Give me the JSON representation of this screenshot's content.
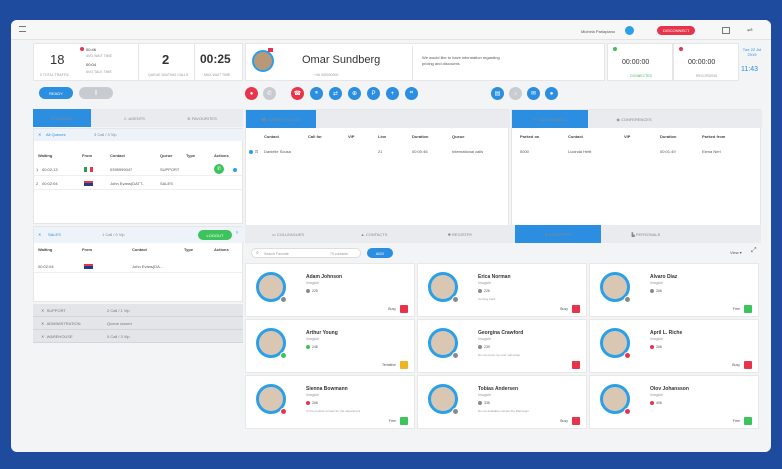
{
  "header": {
    "user": "Michela Parlapiano",
    "status_button": "DISCONNECT"
  },
  "stats": {
    "calls_count": "18",
    "calls_label": "0 TOTAL TRAFFIC",
    "t1": "00:46",
    "t1_label": "AVG WAIT TIME",
    "t2": "00:04",
    "t2_label": "AVG TALK TIME",
    "queue_count": "2",
    "queue_label": "QUEUE WAITING CALLS",
    "waittime": "00:25",
    "waittime_label": "MAX WAIT TIME"
  },
  "caller": {
    "name": "Omar Sundberg",
    "sub": "+46 000000000",
    "note": "We would like to have information regarding pricing and discounts",
    "timer1": "00:00:00",
    "timer1_label": "CONNECTED",
    "timer2": "00:00:00",
    "timer2_label": "RECORDING",
    "date": "Tue 22 Jul 2019",
    "time": "11:43"
  },
  "controls": {
    "pause": "READY",
    "pause2": "||"
  },
  "left_tabs": [
    "QUEUES",
    "AGENTS",
    "FAVOURITES"
  ],
  "queue_info": {
    "label": "All Queues",
    "count": "3 Call / 3 Vip"
  },
  "queue_headers": [
    "Waiting",
    "From",
    "Contact",
    "Queue",
    "Type",
    "Actions"
  ],
  "queue_rows": [
    {
      "idx": "1",
      "waiting": "00:02:13",
      "contact": "0395999047",
      "queue": "SUPPORT"
    },
    {
      "idx": "2",
      "waiting": "00:02:04",
      "contact": "John Evans(DATT..",
      "queue": "SALES"
    }
  ],
  "sales": {
    "label": "SALES",
    "count": "1 Call / 0 Vip",
    "logout": "LOGOUT"
  },
  "sales_headers": [
    "Waiting",
    "From",
    "Contact",
    "Type",
    "Actions"
  ],
  "sales_rows": [
    {
      "waiting": "00:02:04",
      "contact": "John Evans(DA..."
    }
  ],
  "groups": [
    {
      "name": "SUPPORT",
      "info": "2 Call / 1 Vip"
    },
    {
      "name": "ADMINISTRATION",
      "info": "Queue closed"
    },
    {
      "name": "WAREHOUSE",
      "info": "0 Call / 3 Vip"
    }
  ],
  "current_calls": {
    "tab": "CURRENT CALLS",
    "headers": [
      "Contact",
      "Call for",
      "VIP",
      "Line",
      "Duration",
      "Queue"
    ],
    "row": {
      "contact": "Danielle Sousa",
      "line": "21",
      "duration": "00:00:46",
      "queue": "International calls"
    }
  },
  "parked": {
    "tab": "CALL PARKED",
    "tab2": "CONFERENCES",
    "headers": [
      "Parked on",
      "Contact",
      "VIP",
      "Duration",
      "Parked from"
    ],
    "row": {
      "on": "5000",
      "contact": "Lucinda Heltt",
      "duration": "00:01:49",
      "from": "Elena Neri"
    }
  },
  "dir_tabs": [
    "COLLEAGUES",
    "CONTACTS",
    "REGISTRY",
    "MONITOR",
    "FAVORITES",
    "PERSONALS"
  ],
  "search": {
    "placeholder": "Search Favorite",
    "count": "79 contacts",
    "add": "ADD",
    "view": "View"
  },
  "contacts": [
    {
      "name": "Adam Johnson",
      "company": "Imagicle",
      "ext": "225",
      "status": "Busy",
      "color": "#e8344b",
      "dot": "#8a8a8a",
      "note": ""
    },
    {
      "name": "Erica Norman",
      "company": "Imagicle",
      "ext": "226",
      "status": "Busy",
      "color": "#e8344b",
      "dot": "#8a8a8a",
      "note": "Coming back"
    },
    {
      "name": "Alvaro Diaz",
      "company": "Imagicle",
      "ext": "266",
      "status": "Free",
      "color": "#3cc35c",
      "dot": "#8a8a8a",
      "note": ""
    },
    {
      "name": "Arthur Young",
      "company": "Imagicle",
      "ext": "246",
      "status": "Tentative",
      "color": "#f0b323",
      "dot": "#3cc35c",
      "note": ""
    },
    {
      "name": "Georgina Crawford",
      "company": "Imagicle",
      "ext": "239",
      "status": "",
      "color": "#e8344b",
      "dot": "#8a8a8a",
      "note": "Do not press my user call today"
    },
    {
      "name": "April L. Riche",
      "company": "Imagicle",
      "ext": "266",
      "status": "Busy",
      "color": "#e8344b",
      "dot": "#e8344b",
      "note": ""
    },
    {
      "name": "Sienna Bowmann",
      "company": "Imagicle",
      "ext": "266",
      "status": "Free",
      "color": "#3cc35c",
      "dot": "#e8344b",
      "note": "In the product contact for the department"
    },
    {
      "name": "Tobias Andersen",
      "company": "Imagicle",
      "ext": "335",
      "status": "Busy",
      "color": "#e8344b",
      "dot": "#8a8a8a",
      "note": "Do not available contact the Mail team"
    },
    {
      "name": "Olov Johansson",
      "company": "Imagicle",
      "ext": "406",
      "status": "Free",
      "color": "#3cc35c",
      "dot": "#e8344b",
      "note": ""
    }
  ]
}
